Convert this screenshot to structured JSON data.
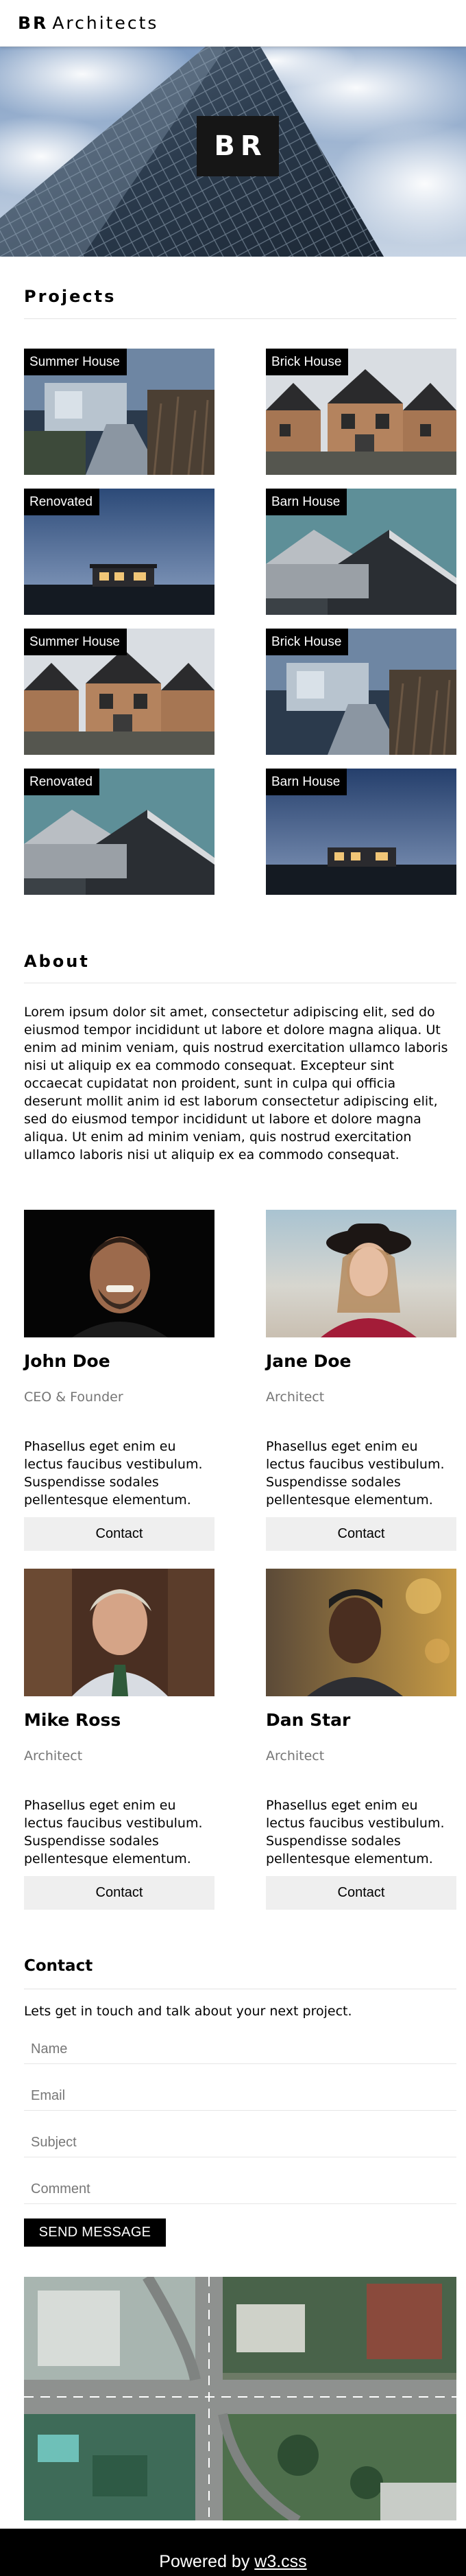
{
  "nav": {
    "brand_bold": "BR",
    "brand_rest": "Architects"
  },
  "hero": {
    "badge": "BR"
  },
  "projects": {
    "title": "Projects",
    "items": [
      {
        "label": "Summer House"
      },
      {
        "label": "Brick House"
      },
      {
        "label": "Renovated"
      },
      {
        "label": "Barn House"
      },
      {
        "label": "Summer House"
      },
      {
        "label": "Brick House"
      },
      {
        "label": "Renovated"
      },
      {
        "label": "Barn House"
      }
    ]
  },
  "about": {
    "title": "About",
    "text": "Lorem ipsum dolor sit amet, consectetur adipiscing elit, sed do eiusmod tempor incididunt ut labore et dolore magna aliqua. Ut enim ad minim veniam, quis nostrud exercitation ullamco laboris nisi ut aliquip ex ea commodo consequat. Excepteur sint occaecat cupidatat non proident, sunt in culpa qui officia deserunt mollit anim id est laborum consectetur adipiscing elit, sed do eiusmod tempor incididunt ut labore et dolore magna aliqua. Ut enim ad minim veniam, quis nostrud exercitation ullamco laboris nisi ut aliquip ex ea commodo consequat."
  },
  "team": [
    {
      "name": "John Doe",
      "role": "CEO & Founder",
      "desc": "Phasellus eget enim eu lectus faucibus vestibulum. Suspendisse sodales pellentesque elementum.",
      "button": "Contact"
    },
    {
      "name": "Jane Doe",
      "role": "Architect",
      "desc": "Phasellus eget enim eu lectus faucibus vestibulum. Suspendisse sodales pellentesque elementum.",
      "button": "Contact"
    },
    {
      "name": "Mike Ross",
      "role": "Architect",
      "desc": "Phasellus eget enim eu lectus faucibus vestibulum. Suspendisse sodales pellentesque elementum.",
      "button": "Contact"
    },
    {
      "name": "Dan Star",
      "role": "Architect",
      "desc": "Phasellus eget enim eu lectus faucibus vestibulum. Suspendisse sodales pellentesque elementum.",
      "button": "Contact"
    }
  ],
  "contact": {
    "title": "Contact",
    "intro": "Lets get in touch and talk about your next project.",
    "name_placeholder": "Name",
    "email_placeholder": "Email",
    "subject_placeholder": "Subject",
    "comment_placeholder": "Comment",
    "send_label": "SEND MESSAGE"
  },
  "footer": {
    "powered_by": "Powered by",
    "link_text": "w3.css"
  }
}
